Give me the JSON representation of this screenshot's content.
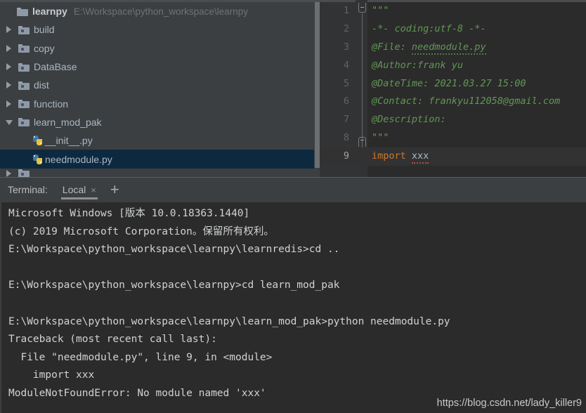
{
  "project_tree": {
    "root": {
      "name": "learnpy",
      "path": "E:\\Workspace\\python_workspace\\learnpy",
      "icon": "folder-icon"
    },
    "items": [
      {
        "label": "build",
        "icon": "folder-icon",
        "arrow": "chevron-right-icon",
        "indent": 0,
        "type": "folder",
        "selected": false
      },
      {
        "label": "copy",
        "icon": "folder-icon",
        "arrow": "chevron-right-icon",
        "indent": 0,
        "type": "folder",
        "selected": false
      },
      {
        "label": "DataBase",
        "icon": "folder-icon",
        "arrow": "chevron-right-icon",
        "indent": 0,
        "type": "folder",
        "selected": false
      },
      {
        "label": "dist",
        "icon": "folder-icon",
        "arrow": "chevron-right-icon",
        "indent": 0,
        "type": "folder",
        "selected": false
      },
      {
        "label": "function",
        "icon": "folder-icon",
        "arrow": "chevron-right-icon",
        "indent": 0,
        "type": "folder",
        "selected": false
      },
      {
        "label": "learn_mod_pak",
        "icon": "folder-icon",
        "arrow": "chevron-down-icon",
        "indent": 0,
        "type": "folder",
        "selected": false
      },
      {
        "label": "__init__.py",
        "icon": "python-file-icon",
        "arrow": "none",
        "indent": 1,
        "type": "file",
        "selected": false
      },
      {
        "label": "needmodule.py",
        "icon": "python-file-icon",
        "arrow": "none",
        "indent": 1,
        "type": "file",
        "selected": true
      }
    ]
  },
  "editor": {
    "lines": [
      {
        "num": "1",
        "text": "\"\"\"",
        "style": "doc",
        "fold": "open"
      },
      {
        "num": "2",
        "text": "-*- coding:utf-8 -*-",
        "style": "doc",
        "fold": "none"
      },
      {
        "num": "3",
        "text": "@File: needmodule.py",
        "style": "doc",
        "fold": "none"
      },
      {
        "num": "4",
        "text": "@Author:frank yu",
        "style": "doc",
        "fold": "none"
      },
      {
        "num": "5",
        "text": "@DateTime: 2021.03.27 15:00",
        "style": "doc",
        "fold": "none"
      },
      {
        "num": "6",
        "text": "@Contact: frankyu112058@gmail.com",
        "style": "doc",
        "fold": "none"
      },
      {
        "num": "7",
        "text": "@Description:",
        "style": "doc",
        "fold": "none"
      },
      {
        "num": "8",
        "text": "\"\"\"",
        "style": "doc",
        "fold": "close"
      },
      {
        "num": "9",
        "text": "import xxx",
        "style": "code",
        "fold": "none"
      }
    ],
    "code_line9": {
      "keyword": "import",
      "module": "xxx"
    }
  },
  "terminal": {
    "title": "Terminal:",
    "tab_label": "Local",
    "tab_close": "×",
    "add_label": "+",
    "lines": [
      "Microsoft Windows [版本 10.0.18363.1440]",
      "(c) 2019 Microsoft Corporation。保留所有权利。",
      "E:\\Workspace\\python_workspace\\learnpy\\learnredis>cd ..",
      "",
      "E:\\Workspace\\python_workspace\\learnpy>cd learn_mod_pak",
      "",
      "E:\\Workspace\\python_workspace\\learnpy\\learn_mod_pak>python needmodule.py",
      "Traceback (most recent call last):",
      "  File \"needmodule.py\", line 9, in <module>",
      "    import xxx",
      "ModuleNotFoundError: No module named 'xxx'"
    ]
  },
  "watermark": {
    "text": "https://blog.csdn.net/lady_killer9"
  },
  "colors": {
    "panel_bg": "#3c3f41",
    "editor_bg": "#2b2b2b",
    "gutter_bg": "#313335",
    "selection_bg": "#0d293f",
    "text": "#a9b7c6",
    "docstring": "#629755",
    "keyword": "#cc7832",
    "terminal_text": "#cfd2d4"
  }
}
